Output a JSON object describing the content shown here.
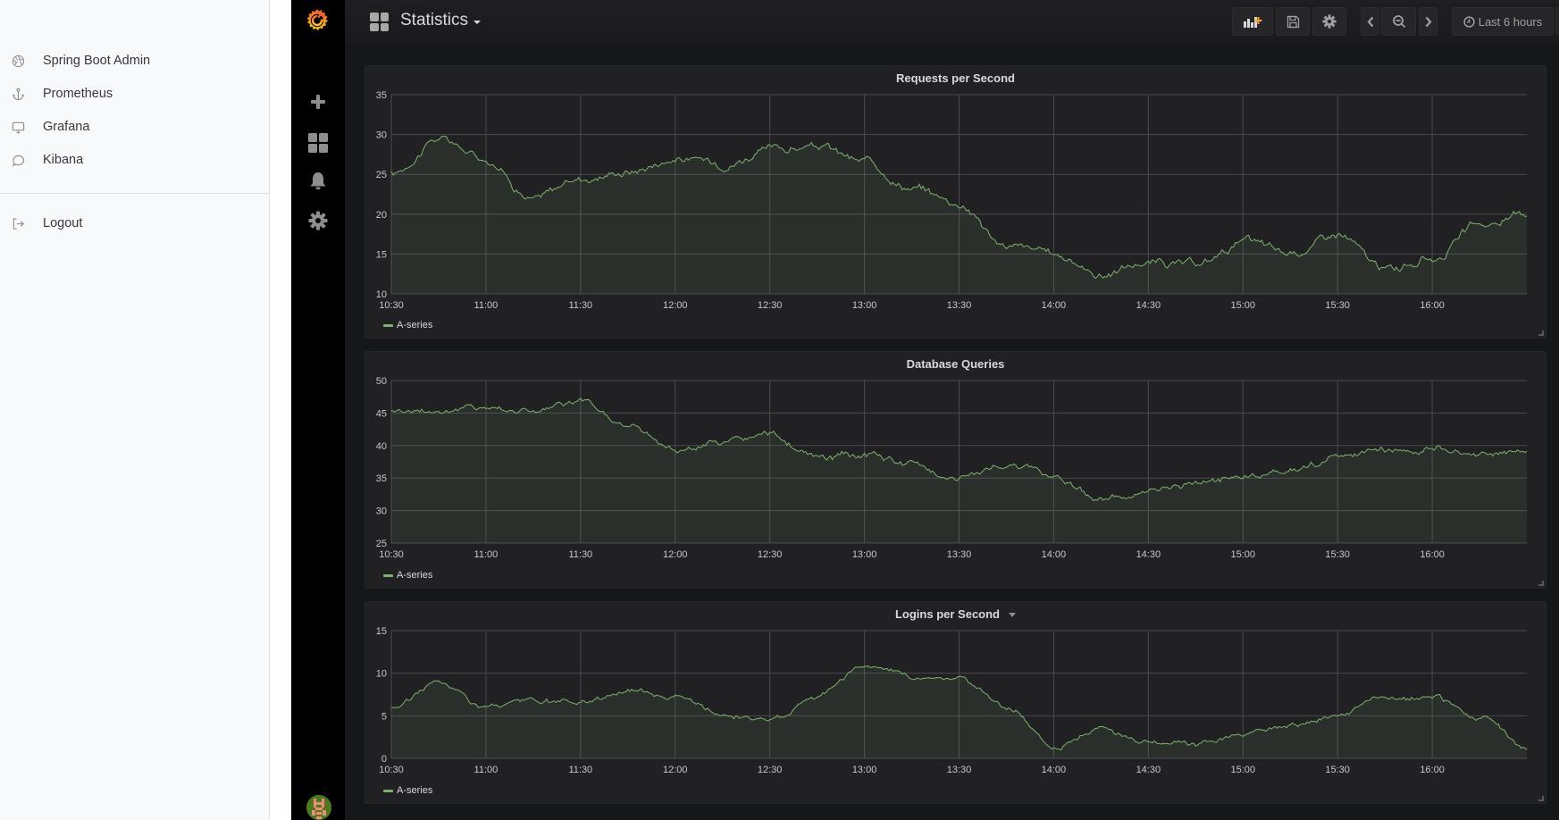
{
  "sidebar": {
    "items": [
      {
        "label": "Spring Boot Admin",
        "icon": "aperture-icon"
      },
      {
        "label": "Prometheus",
        "icon": "anchor-icon"
      },
      {
        "label": "Grafana",
        "icon": "monitor-icon"
      },
      {
        "label": "Kibana",
        "icon": "chat-bubble-icon"
      }
    ],
    "logout_label": "Logout"
  },
  "nav": {
    "icons": [
      "grafana-logo",
      "plus-icon",
      "dashboards-grid-icon",
      "bell-icon",
      "gear-icon",
      "user-avatar"
    ]
  },
  "topbar": {
    "dashboard_title": "Statistics",
    "time_range_label": "Last 6 hours",
    "buttons": [
      "add-panel",
      "save-dashboard",
      "dashboard-settings",
      "time-shift-back",
      "zoom-out",
      "time-shift-forward",
      "time-range-picker"
    ]
  },
  "colors": {
    "series": "#7eb26d",
    "background": "#161719",
    "panel": "#212124",
    "grid": "#4a4a4d",
    "text": "#d8d9da",
    "logo_orange": "#f5821f",
    "add_panel_plus": "#f5a623"
  },
  "chart_data": [
    {
      "type": "area",
      "title": "Requests per Second",
      "legend": [
        "A-series"
      ],
      "legend_position": "bottom-left",
      "grid": true,
      "xlabel": "",
      "ylabel": "",
      "xlim": [
        "10:30",
        "16:30"
      ],
      "ylim": [
        10,
        35
      ],
      "x_ticks": [
        "10:30",
        "11:00",
        "11:30",
        "12:00",
        "12:30",
        "13:00",
        "13:30",
        "14:00",
        "14:30",
        "15:00",
        "15:30",
        "16:00"
      ],
      "y_ticks": [
        10,
        15,
        20,
        25,
        30,
        35
      ],
      "x": [
        "10:30",
        "10:45",
        "11:00",
        "11:15",
        "11:30",
        "11:45",
        "12:00",
        "12:15",
        "12:30",
        "12:45",
        "13:00",
        "13:15",
        "13:30",
        "13:45",
        "14:00",
        "14:15",
        "14:30",
        "14:45",
        "15:00",
        "15:15",
        "15:30",
        "15:45",
        "16:00",
        "16:15",
        "16:30"
      ],
      "series": [
        {
          "name": "A-series",
          "values": [
            25,
            29.5,
            27,
            22,
            24.5,
            25.5,
            27,
            26.5,
            28,
            28.5,
            26.5,
            23.5,
            21.5,
            16,
            15,
            12.5,
            14,
            13.5,
            16.5,
            15,
            17.5,
            13,
            14.5,
            18.5,
            20
          ]
        }
      ]
    },
    {
      "type": "area",
      "title": "Database Queries",
      "legend": [
        "A-series"
      ],
      "legend_position": "bottom-left",
      "grid": true,
      "xlabel": "",
      "ylabel": "",
      "xlim": [
        "10:30",
        "16:30"
      ],
      "ylim": [
        25,
        50
      ],
      "x_ticks": [
        "10:30",
        "11:00",
        "11:30",
        "12:00",
        "12:30",
        "13:00",
        "13:30",
        "14:00",
        "14:30",
        "15:00",
        "15:30",
        "16:00"
      ],
      "y_ticks": [
        25,
        30,
        35,
        40,
        45,
        50
      ],
      "x": [
        "10:30",
        "10:45",
        "11:00",
        "11:15",
        "11:30",
        "11:45",
        "12:00",
        "12:15",
        "12:30",
        "12:45",
        "13:00",
        "13:15",
        "13:30",
        "13:45",
        "14:00",
        "14:15",
        "14:30",
        "14:45",
        "15:00",
        "15:15",
        "15:30",
        "15:45",
        "16:00",
        "16:15",
        "16:30"
      ],
      "series": [
        {
          "name": "A-series",
          "values": [
            45.5,
            45.5,
            46,
            45.5,
            46.5,
            43,
            39.5,
            40.5,
            41.5,
            38,
            38.5,
            37,
            35,
            37,
            35.5,
            32,
            32.5,
            34.5,
            35,
            36.5,
            38,
            39,
            39.5,
            38.5,
            39.5
          ]
        }
      ]
    },
    {
      "type": "area",
      "title": "Logins per Second",
      "legend": [
        "A-series"
      ],
      "legend_position": "bottom-left",
      "grid": true,
      "xlabel": "",
      "ylabel": "",
      "xlim": [
        "10:30",
        "16:30"
      ],
      "ylim": [
        0,
        15
      ],
      "x_ticks": [
        "10:30",
        "11:00",
        "11:30",
        "12:00",
        "12:30",
        "13:00",
        "13:30",
        "14:00",
        "14:30",
        "15:00",
        "15:30",
        "16:00"
      ],
      "y_ticks": [
        0,
        5,
        10,
        15
      ],
      "x": [
        "10:30",
        "10:45",
        "11:00",
        "11:15",
        "11:30",
        "11:45",
        "12:00",
        "12:15",
        "12:30",
        "12:45",
        "13:00",
        "13:15",
        "13:30",
        "13:45",
        "14:00",
        "14:15",
        "14:30",
        "14:45",
        "15:00",
        "15:15",
        "15:30",
        "15:45",
        "16:00",
        "16:15",
        "16:30"
      ],
      "series": [
        {
          "name": "A-series",
          "values": [
            6,
            9,
            6,
            6.5,
            6.5,
            8,
            7.5,
            5,
            4.5,
            7.5,
            11,
            9.5,
            9.5,
            6,
            1.5,
            3.5,
            2,
            1.5,
            3,
            3.5,
            5,
            7,
            7,
            5,
            1
          ]
        }
      ]
    }
  ]
}
